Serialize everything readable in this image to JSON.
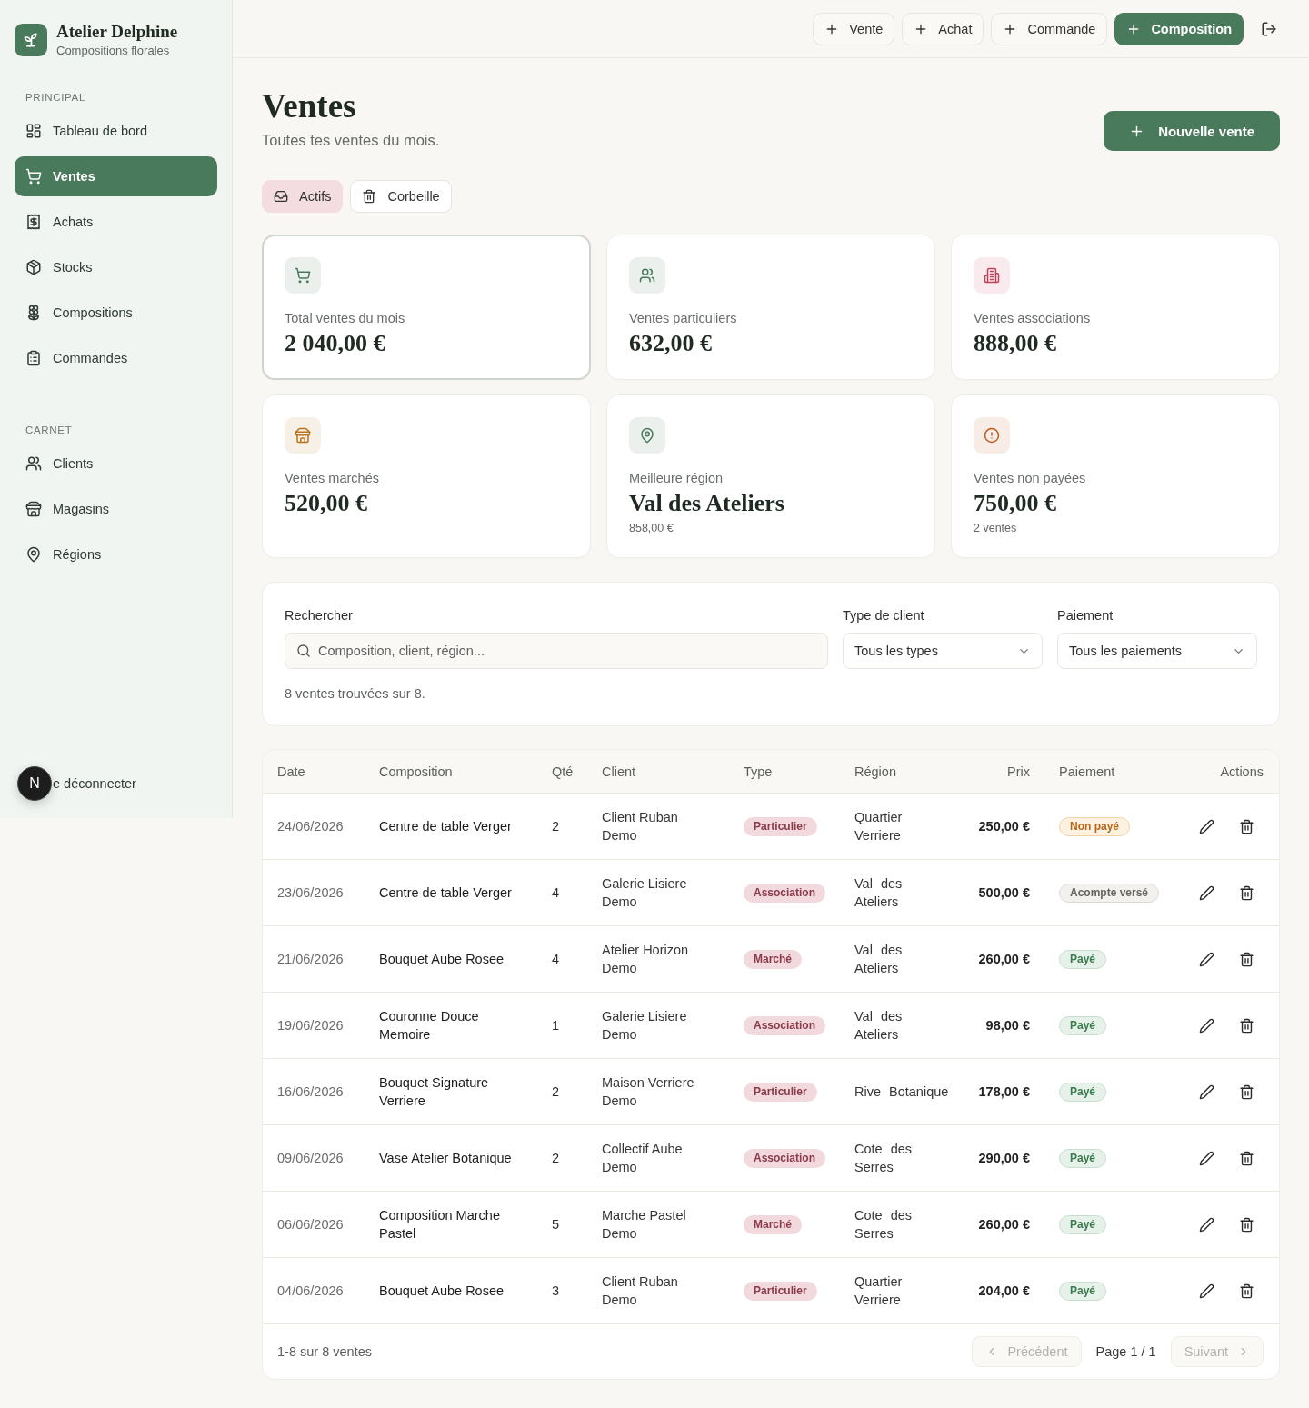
{
  "sidebar": {
    "brand": {
      "name": "Atelier Delphine",
      "tagline": "Compositions florales"
    },
    "sections": [
      {
        "title": "PRINCIPAL",
        "items": [
          {
            "label": "Tableau de bord",
            "selected": false
          },
          {
            "label": "Ventes",
            "selected": true
          },
          {
            "label": "Achats",
            "selected": false
          },
          {
            "label": "Stocks",
            "selected": false
          },
          {
            "label": "Compositions",
            "selected": false
          },
          {
            "label": "Commandes",
            "selected": false
          }
        ]
      },
      {
        "title": "CARNET",
        "items": [
          {
            "label": "Clients",
            "selected": false
          },
          {
            "label": "Magasins",
            "selected": false
          },
          {
            "label": "Régions",
            "selected": false
          }
        ]
      }
    ],
    "logout": {
      "label": "e déconnecter"
    },
    "dev_badge": {
      "label": "N"
    }
  },
  "topbar": {
    "buttons": [
      {
        "label": "Vente",
        "kind": "outline"
      },
      {
        "label": "Achat",
        "kind": "outline"
      },
      {
        "label": "Commande",
        "kind": "outline"
      },
      {
        "label": "Composition",
        "kind": "primary"
      }
    ]
  },
  "header": {
    "title": "Ventes",
    "subtitle": "Toutes tes ventes du mois.",
    "action": "Nouvelle vente"
  },
  "tabs": [
    {
      "label": "Actifs",
      "selected": true
    },
    {
      "label": "Corbeille",
      "selected": false
    }
  ],
  "stats": [
    {
      "label": "Total ventes du mois",
      "value": "2 040,00 €",
      "selected": true,
      "color": "#4a7a5c"
    },
    {
      "label": "Ventes particuliers",
      "value": "632,00 €",
      "selected": false,
      "color": "#4a7a5c"
    },
    {
      "label": "Ventes associations",
      "value": "888,00 €",
      "selected": false,
      "color": "#c2415a"
    },
    {
      "label": "Ventes marchés",
      "value": "520,00 €",
      "selected": false,
      "color": "#b7741c"
    },
    {
      "label": "Meilleure région",
      "value": "Val des Ateliers",
      "note": "858,00 €",
      "selected": false,
      "color": "#4a7a5c"
    },
    {
      "label": "Ventes non payées",
      "value": "750,00 €",
      "note": "2 ventes",
      "selected": false,
      "color": "#c05a1c"
    }
  ],
  "filters": {
    "search": {
      "label": "Rechercher",
      "placeholder": "Composition, client, région..."
    },
    "selects": [
      {
        "label": "Type de client",
        "value": "Tous les types"
      },
      {
        "label": "Paiement",
        "value": "Tous les paiements"
      }
    ],
    "result_count": "8 ventes trouvées sur 8."
  },
  "table": {
    "columns": [
      "Date",
      "Composition",
      "Qté",
      "Client",
      "Type",
      "Région",
      "Prix",
      "Paiement",
      "Actions"
    ],
    "rows": [
      {
        "date": "24/06/2026",
        "composition": "Centre de table Verger",
        "qty": "2",
        "client": "Client Ruban Demo",
        "type": "Particulier",
        "region": "Quartier Verriere",
        "price": "250,00 €",
        "payment": {
          "label": "Non payé",
          "kind": "unpaid"
        }
      },
      {
        "date": "23/06/2026",
        "composition": "Centre de table Verger",
        "qty": "4",
        "client": "Galerie Lisiere Demo",
        "type": "Association",
        "region": "Val des Ateliers",
        "price": "500,00 €",
        "payment": {
          "label": "Acompte versé",
          "kind": "deposit"
        }
      },
      {
        "date": "21/06/2026",
        "composition": "Bouquet Aube Rosee",
        "qty": "4",
        "client": "Atelier Horizon Demo",
        "type": "Marché",
        "region": "Val des Ateliers",
        "price": "260,00 €",
        "payment": {
          "label": "Payé",
          "kind": "paid"
        }
      },
      {
        "date": "19/06/2026",
        "composition": "Couronne Douce Memoire",
        "qty": "1",
        "client": "Galerie Lisiere Demo",
        "type": "Association",
        "region": "Val des Ateliers",
        "price": "98,00 €",
        "payment": {
          "label": "Payé",
          "kind": "paid"
        }
      },
      {
        "date": "16/06/2026",
        "composition": "Bouquet Signature Verriere",
        "qty": "2",
        "client": "Maison Verriere Demo",
        "type": "Particulier",
        "region": "Rive Botanique",
        "price": "178,00 €",
        "payment": {
          "label": "Payé",
          "kind": "paid"
        }
      },
      {
        "date": "09/06/2026",
        "composition": "Vase Atelier Botanique",
        "qty": "2",
        "client": "Collectif Aube Demo",
        "type": "Association",
        "region": "Cote des Serres",
        "price": "290,00 €",
        "payment": {
          "label": "Payé",
          "kind": "paid"
        }
      },
      {
        "date": "06/06/2026",
        "composition": "Composition Marche Pastel",
        "qty": "5",
        "client": "Marche Pastel Demo",
        "type": "Marché",
        "region": "Cote des Serres",
        "price": "260,00 €",
        "payment": {
          "label": "Payé",
          "kind": "paid"
        }
      },
      {
        "date": "04/06/2026",
        "composition": "Bouquet Aube Rosee",
        "qty": "3",
        "client": "Client Ruban Demo",
        "type": "Particulier",
        "region": "Quartier Verriere",
        "price": "204,00 €",
        "payment": {
          "label": "Payé",
          "kind": "paid"
        }
      }
    ],
    "footer": {
      "summary": "1-8 sur 8 ventes",
      "previous": {
        "label": "Précédent",
        "disabled": true
      },
      "page": "Page 1 / 1",
      "next": {
        "label": "Suivant",
        "disabled": true
      }
    }
  }
}
